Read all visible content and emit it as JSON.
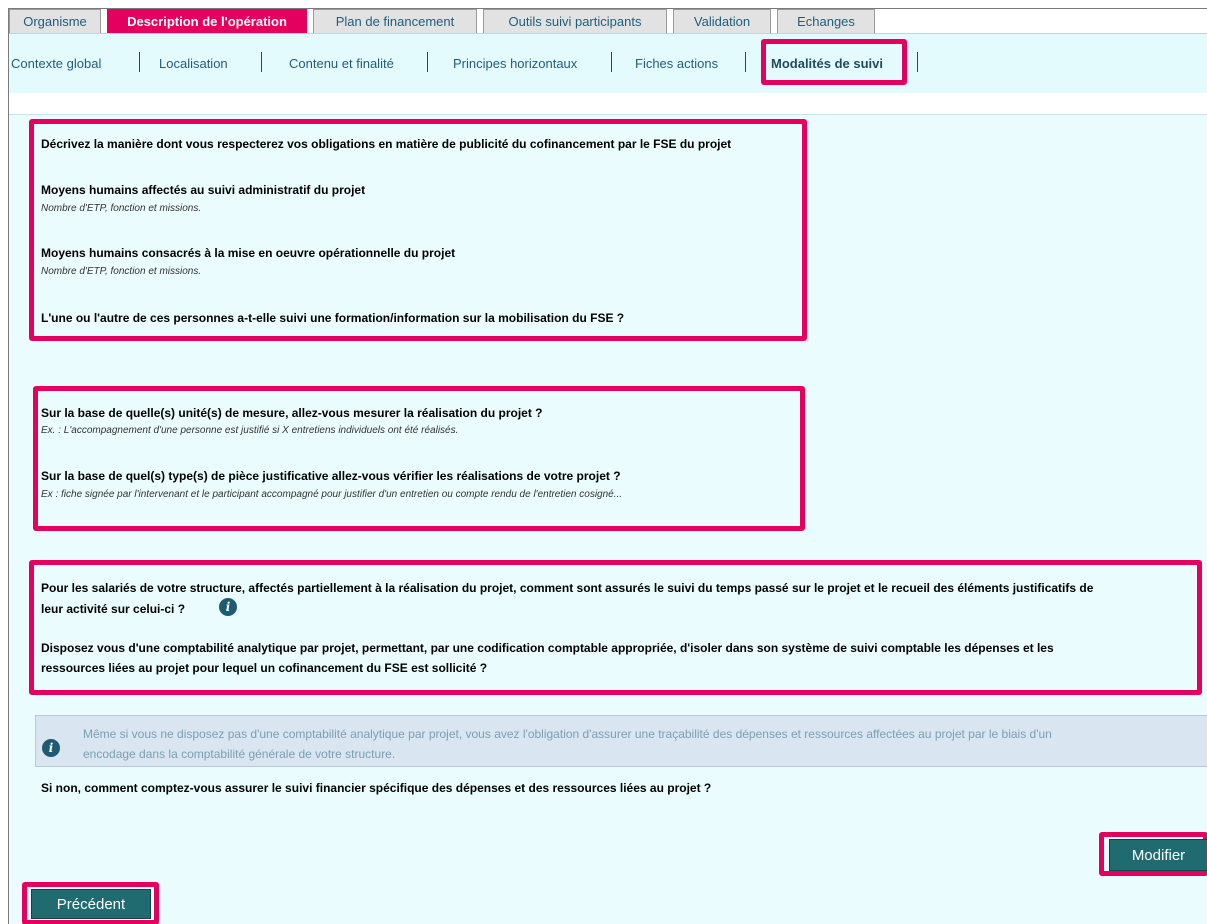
{
  "tabs": [
    {
      "label": "Organisme"
    },
    {
      "label": "Description de l'opération"
    },
    {
      "label": "Plan de financement"
    },
    {
      "label": "Outils suivi participants"
    },
    {
      "label": "Validation"
    },
    {
      "label": "Echanges"
    }
  ],
  "subtabs": [
    {
      "label": "Contexte global"
    },
    {
      "label": "Localisation"
    },
    {
      "label": "Contenu et finalité"
    },
    {
      "label": "Principes horizontaux"
    },
    {
      "label": "Fiches actions"
    },
    {
      "label": "Modalités de suivi"
    }
  ],
  "section1": {
    "q1": "Décrivez la manière dont vous respecterez vos obligations en matière de publicité du cofinancement par le FSE du projet",
    "q2": "Moyens humains affectés au suivi administratif du projet",
    "q2_hint": "Nombre d'ETP, fonction et missions.",
    "q3": "Moyens humains consacrés à la mise en oeuvre opérationnelle du projet",
    "q3_hint": "Nombre d'ETP, fonction et missions.",
    "q4": "L'une ou l'autre de ces personnes a-t-elle suivi une formation/information sur la mobilisation du FSE ?"
  },
  "section2": {
    "q1": "Sur la base de quelle(s) unité(s) de mesure, allez-vous mesurer la réalisation du projet ?",
    "q1_hint": "Ex. : L'accompagnement d'une personne est justifié si X entretiens individuels ont été réalisés.",
    "q2": "Sur la base de quel(s) type(s) de pièce justificative allez-vous vérifier les réalisations de votre projet ?",
    "q2_hint": "Ex : fiche signée par l'intervenant et le participant accompagné pour justifier d'un entretien ou compte rendu de l'entretien cosigné..."
  },
  "section3": {
    "q1_line1": "Pour les salariés de votre structure, affectés partiellement à la réalisation du projet, comment sont assurés le suivi du temps passé sur le projet et le recueil des éléments justificatifs de",
    "q1_line2": "leur activité sur celui-ci ?",
    "q2_line1": "Disposez vous d'une comptabilité analytique par projet, permettant, par une codification comptable appropriée, d'isoler dans son système de suivi comptable les dépenses et les",
    "q2_line2": "ressources liées au projet pour lequel un cofinancement du FSE est sollicité ?"
  },
  "info": {
    "icon_glyph": "i",
    "line1": "Même si vous ne disposez pas d'une comptabilité analytique par projet, vous avez l'obligation d'assurer une traçabilité des dépenses et ressources affectées au projet par le biais d'un",
    "line2": "encodage dans la comptabilité générale de votre structure."
  },
  "question_after_info": "Si non, comment comptez-vous assurer le suivi financier spécifique des dépenses et des ressources liées au projet ?",
  "buttons": {
    "modifier": "Modifier",
    "precedent": "Précédent"
  },
  "colors": {
    "accent": "#e4005e",
    "button": "#1f6b6f",
    "panel": "#eafcfd"
  }
}
